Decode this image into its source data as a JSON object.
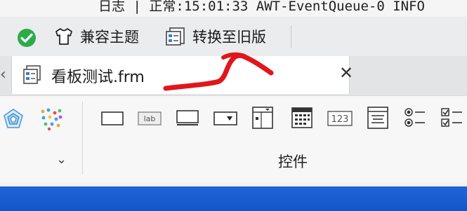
{
  "log_bar": {
    "title": "日志",
    "divider": "|",
    "level_cn": "正常",
    "text": ":15:01:33 AWT-EventQueue-0 INFO"
  },
  "toolbar": {
    "theme_label": "兼容主题",
    "convert_label": "转换至旧版",
    "colors": {
      "ok_green": "#2cab4a"
    }
  },
  "tabs": [
    {
      "label": "看板测试.frm",
      "icon": "form-file-icon"
    }
  ],
  "palette": {
    "caption": "控件",
    "items": [
      {
        "icon": "panel-icon"
      },
      {
        "icon": "label-icon",
        "text": "lab"
      },
      {
        "icon": "button-icon"
      },
      {
        "icon": "combobox-icon"
      },
      {
        "icon": "list-window-icon"
      },
      {
        "icon": "calendar-icon"
      },
      {
        "icon": "number-field-icon",
        "text": "123"
      },
      {
        "icon": "text-area-icon"
      },
      {
        "icon": "radio-group-icon"
      },
      {
        "icon": "checkbox-group-icon"
      }
    ]
  },
  "colors": {
    "annotation": "#e0161c",
    "bottom_strip": "#1e63d8"
  }
}
